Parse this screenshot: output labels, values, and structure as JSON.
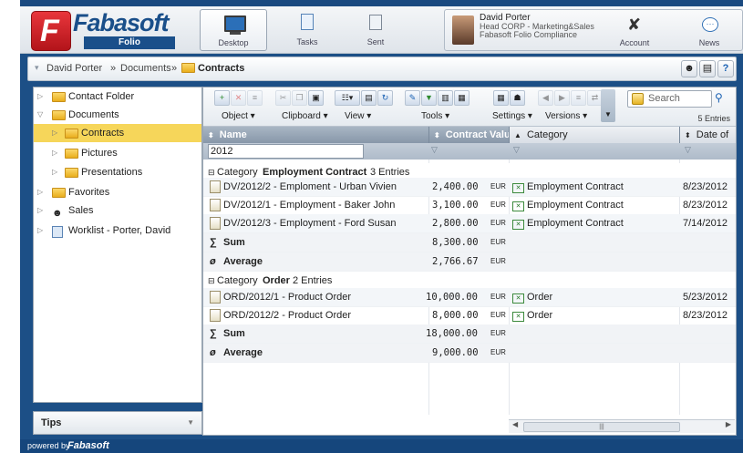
{
  "logo": {
    "letter": "F",
    "word": "Fabasoft",
    "product": "Folio"
  },
  "nav": {
    "desktop": "Desktop",
    "tasks": "Tasks",
    "sent": "Sent",
    "account": "Account",
    "news": "News"
  },
  "user": {
    "name": "David Porter",
    "org": "Head CORP - Marketing&Sales",
    "role": "Fabasoft Folio Compliance"
  },
  "breadcrumb": {
    "arrow": "▾",
    "items": [
      "David Porter",
      "Documents",
      "Contracts"
    ],
    "separator": "»"
  },
  "tree": [
    {
      "label": "Contact Folder",
      "tri": "▷"
    },
    {
      "label": "Documents",
      "tri": "▽"
    },
    {
      "label": "Contracts",
      "tri": "▷"
    },
    {
      "label": "Pictures",
      "tri": "▷"
    },
    {
      "label": "Presentations",
      "tri": "▷"
    },
    {
      "label": "Favorites",
      "tri": "▷"
    },
    {
      "label": "Sales",
      "tri": "▷"
    },
    {
      "label": "Worklist - Porter, David",
      "tri": "▷"
    }
  ],
  "tips": {
    "label": "Tips"
  },
  "toolbar": {
    "object": "Object ▾",
    "clipboard": "Clipboard ▾",
    "view": "View ▾",
    "tools": "Tools ▾",
    "settings": "Settings ▾",
    "versions": "Versions ▾",
    "search_placeholder": "Search",
    "entries": "5 Entries"
  },
  "columns": {
    "name": "Name",
    "value": "Contract Value",
    "category": "Category",
    "date": "Date of"
  },
  "filter": {
    "name_value": "2012"
  },
  "groups": [
    {
      "prefix": "Category",
      "name": "Employment Contract",
      "count": "3 Entries",
      "rows": [
        {
          "name": "DV/2012/2 - Emploment - Urban Vivien",
          "value": "2,400.00",
          "cur": "EUR",
          "category": "Employment Contract",
          "date": "8/23/2012"
        },
        {
          "name": "DV/2012/1 - Employment - Baker John",
          "value": "3,100.00",
          "cur": "EUR",
          "category": "Employment Contract",
          "date": "8/23/2012"
        },
        {
          "name": "DV/2012/3 - Employment - Ford Susan",
          "value": "2,800.00",
          "cur": "EUR",
          "category": "Employment Contract",
          "date": "7/14/2012"
        }
      ],
      "sum": {
        "label": "Sum",
        "sym": "∑",
        "value": "8,300.00",
        "cur": "EUR"
      },
      "avg": {
        "label": "Average",
        "sym": "ø",
        "value": "2,766.67",
        "cur": "EUR"
      }
    },
    {
      "prefix": "Category",
      "name": "Order",
      "count": "2 Entries",
      "rows": [
        {
          "name": "ORD/2012/1 - Product Order",
          "value": "10,000.00",
          "cur": "EUR",
          "category": "Order",
          "date": "5/23/2012"
        },
        {
          "name": "ORD/2012/2 - Product Order",
          "value": "8,000.00",
          "cur": "EUR",
          "category": "Order",
          "date": "8/23/2012"
        }
      ],
      "sum": {
        "label": "Sum",
        "sym": "∑",
        "value": "18,000.00",
        "cur": "EUR"
      },
      "avg": {
        "label": "Average",
        "sym": "ø",
        "value": "9,000.00",
        "cur": "EUR"
      }
    }
  ],
  "footer": {
    "powered": "powered by",
    "brand": "Fabasoft"
  },
  "colors": {
    "header_blue": "#1c4f86",
    "selection": "#f6d65a",
    "logo_red": "#d4232a"
  }
}
